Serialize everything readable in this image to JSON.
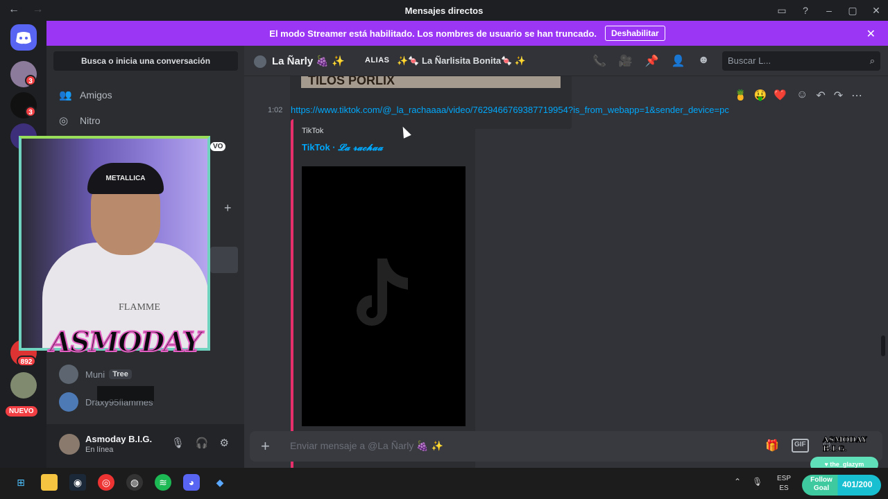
{
  "window": {
    "title": "Mensajes directos",
    "back_icon": "←",
    "forward_icon": "→",
    "controls": [
      "inbox-icon",
      "help-icon",
      "minimize-icon",
      "maximize-icon",
      "close-icon"
    ]
  },
  "banner": {
    "text": "El modo Streamer está habilitado. Los nombres de usuario se han truncado.",
    "button_label": "Deshabilitar",
    "color": "#9b36f5"
  },
  "servers": {
    "badges": [
      "3",
      "3",
      "892"
    ],
    "new_label": "NUEVO"
  },
  "dm_sidebar": {
    "search_label": "Busca o inicia una conversación",
    "nav_friends": "Amigos",
    "nav_nitro": "Nitro",
    "partial_badge": "VO",
    "dm_items": [
      {
        "name": "Muni",
        "badge": "Tree"
      },
      {
        "name": "Draxy95flammes"
      }
    ]
  },
  "user_panel": {
    "name": "Asmoday B.I.G.",
    "status": "En línea"
  },
  "channel": {
    "name": "La Ñarly 🍇 ✨",
    "alias_label": "ALIAS",
    "alias_value": "✨🍬 La Ñarlisita Bonita🍬 ✨",
    "search_placeholder": "Buscar L..."
  },
  "prev_media_text": "TILOS PORLIX",
  "message": {
    "time": "1:02",
    "link": "https://www.tiktok.com/@_la_rachaaaa/video/7629466769387719954?is_from_webapp=1&sender_device=pc",
    "embed_provider": "TikTok",
    "embed_title_prefix": "TikTok · ",
    "embed_title_name": "𝓛𝓪 𝓻𝓪𝓬𝓱𝓪𝓪"
  },
  "reactions": [
    "🍍",
    "🤑",
    "❤️"
  ],
  "composer": {
    "placeholder": "Enviar mensaje a @La Ñarly 🍇 ✨"
  },
  "overlay": {
    "logo_text": "ASMODAY",
    "hoodie_text": "FLAMME",
    "beanie_text": "METALLICA",
    "brand_text": "ASMODAY B.I.G.",
    "follow_user": "the_glazym",
    "goal_label": "Follow Goal",
    "goal_count": "401/200"
  },
  "taskbar": {
    "lang_line1": "ESP",
    "lang_line2": "ES"
  },
  "colors": {
    "accent": "#5865f2",
    "link": "#00a8fc",
    "embed_bar": "#e72f6b"
  }
}
